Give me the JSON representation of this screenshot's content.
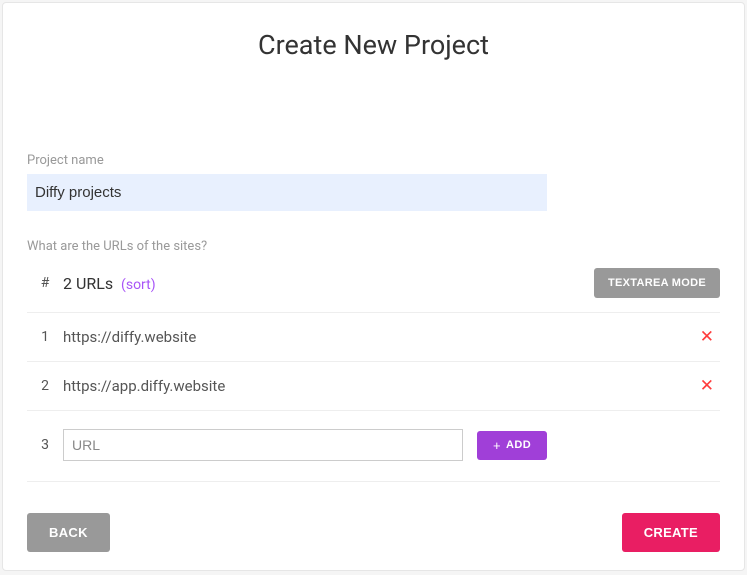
{
  "title": "Create New Project",
  "project_name": {
    "label": "Project name",
    "value": "Diffy projects"
  },
  "urls_question": "What are the URLs of the sites?",
  "header": {
    "hash": "#",
    "count_label": "2 URLs",
    "sort_label": "(sort)",
    "textarea_mode_label": "TEXTAREA MODE"
  },
  "urls": [
    {
      "num": "1",
      "value": "https://diffy.website"
    },
    {
      "num": "2",
      "value": "https://app.diffy.website"
    }
  ],
  "add": {
    "num": "3",
    "placeholder": "URL",
    "button_label": "ADD"
  },
  "footer": {
    "back_label": "BACK",
    "create_label": "CREATE"
  }
}
